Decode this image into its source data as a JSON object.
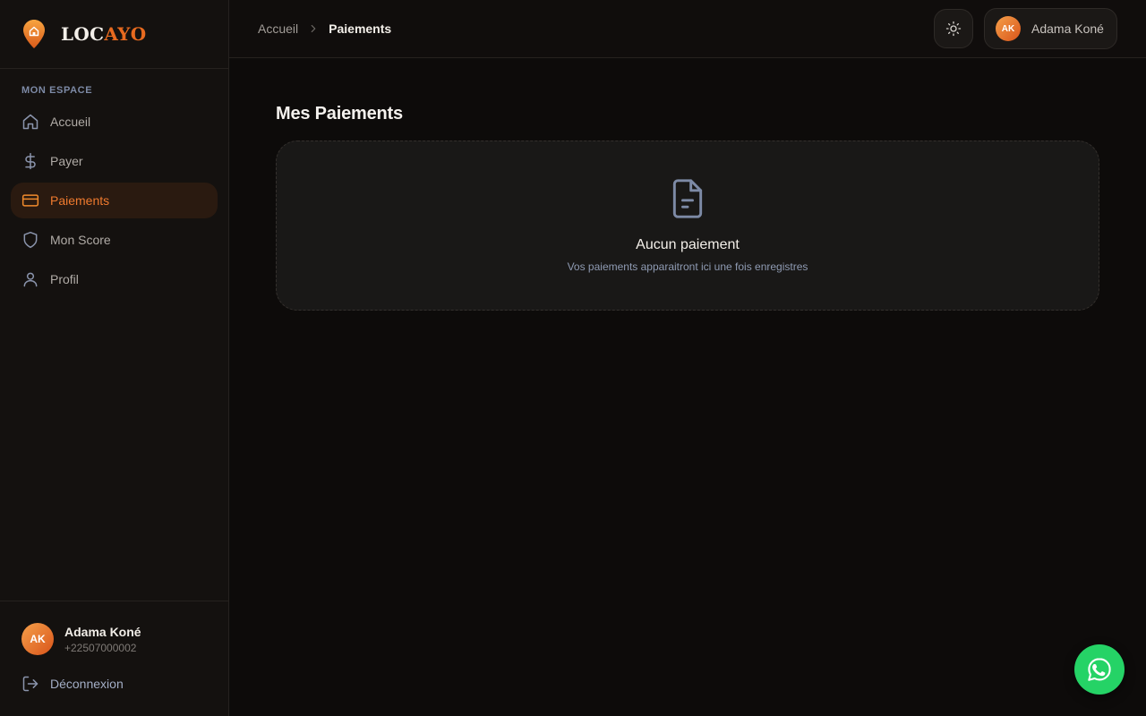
{
  "brand": {
    "part1": "LOC",
    "part2": "AYO",
    "accent": "#e86a1f"
  },
  "sidebar": {
    "section_label": "MON ESPACE",
    "items": [
      {
        "label": "Accueil",
        "icon": "home-icon",
        "active": false
      },
      {
        "label": "Payer",
        "icon": "dollar-icon",
        "active": false
      },
      {
        "label": "Paiements",
        "icon": "credit-card-icon",
        "active": true
      },
      {
        "label": "Mon Score",
        "icon": "shield-icon",
        "active": false
      },
      {
        "label": "Profil",
        "icon": "user-icon",
        "active": false
      }
    ],
    "user": {
      "initials": "AK",
      "name": "Adama Koné",
      "phone": "+22507000002"
    },
    "logout_label": "Déconnexion"
  },
  "header": {
    "breadcrumb": {
      "home": "Accueil",
      "current": "Paiements"
    },
    "theme_icon": "sun-icon",
    "user_chip": {
      "initials": "AK",
      "name": "Adama Koné"
    }
  },
  "main": {
    "title": "Mes Paiements",
    "empty_state": {
      "icon": "document-icon",
      "title": "Aucun paiement",
      "subtitle": "Vos paiements apparaitront ici une fois enregistres"
    }
  },
  "fab": {
    "icon": "whatsapp-icon",
    "color": "#25d366"
  }
}
